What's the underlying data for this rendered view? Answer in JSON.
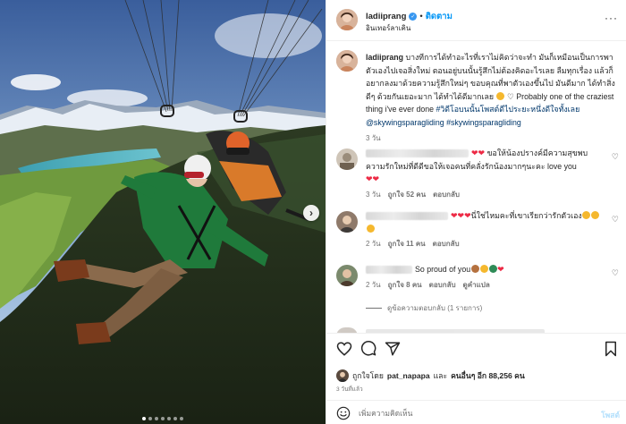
{
  "post": {
    "username": "ladiiprang",
    "follow_label": "ติดตาม",
    "separator": "•",
    "location": "อินเทอร์ลาเคิน",
    "more_label": "···"
  },
  "caption": {
    "username": "ladiiprang",
    "text": " บางทีการได้ทำอะไรที่เราไม่คิดว่าจะทำ มันก็เหมือนเป็นการพาตัวเองไปเจอสิ่งใหม่ ตอนอยู่บนนั้นรู้สึกไม่ต้องคิดอะไรเลย ลืมทุกเรื่อง แล้วก็อยากลงมาด้วยความรู้สึกใหม่ๆ ขอบคุณที่พาตัวเองขึ้นไป มันดีมาก ได้ทำสิ่งดีๆ ด้วยกันเยอะมาก ได้ทำได้ดีมากเลย ",
    "english": "Probably one of the craziest thing i've ever done ",
    "hashtag1": "#วิดีโอบนนั้นโพสต์ดีไประยะหนึ่งดีใจทั้งเลย",
    "mention": "@skywingsparagliding",
    "hashtag2": "#skywingsparagliding",
    "time": "3 วัน"
  },
  "comments": [
    {
      "text": "ขอให้น้องปรางค์มีความสุขพบความรักใหม่ที่ดีดีขอให้เจอคนที่คลั่งรักน้องมากๆนะคะ love you",
      "meta_time": "3 วัน",
      "meta_likes": "ถูกใจ 52 คน",
      "meta_reply": "ตอบกลับ"
    },
    {
      "text": "นี่ใช่ไหมคะที่เขาเรียกว่ารักตัวเอง",
      "meta_time": "2 วัน",
      "meta_likes": "ถูกใจ 11 คน",
      "meta_reply": "ตอบกลับ"
    },
    {
      "text": "So proud of you",
      "meta_time": "2 วัน",
      "meta_likes": "ถูกใจ 8 คน",
      "meta_reply": "ตอบกลับ",
      "meta_translate": "ดูคำแปล"
    }
  ],
  "view_replies": "ดูข้อความตอบกลับ (1 รายการ)",
  "likes": {
    "prefix": "ถูกใจโดย",
    "user": "pat_napapa",
    "middle": "และ",
    "others": "คนอื่นๆ อีก 88,256 คน"
  },
  "post_date": "3 วันที่แล้ว",
  "composer": {
    "placeholder": "เพิ่มความคิดเห็น",
    "post_label": "โพสต์"
  },
  "carousel": {
    "slides": 7,
    "active_index": 0,
    "next_label": "›"
  },
  "icons": [
    "heart-icon",
    "comment-icon",
    "share-icon",
    "bookmark-icon",
    "smile-icon",
    "verified-icon"
  ],
  "colors": {
    "accent": "#0095f6",
    "verified": "#3897f0",
    "link": "#00376b",
    "heart": "#ed2a45"
  }
}
